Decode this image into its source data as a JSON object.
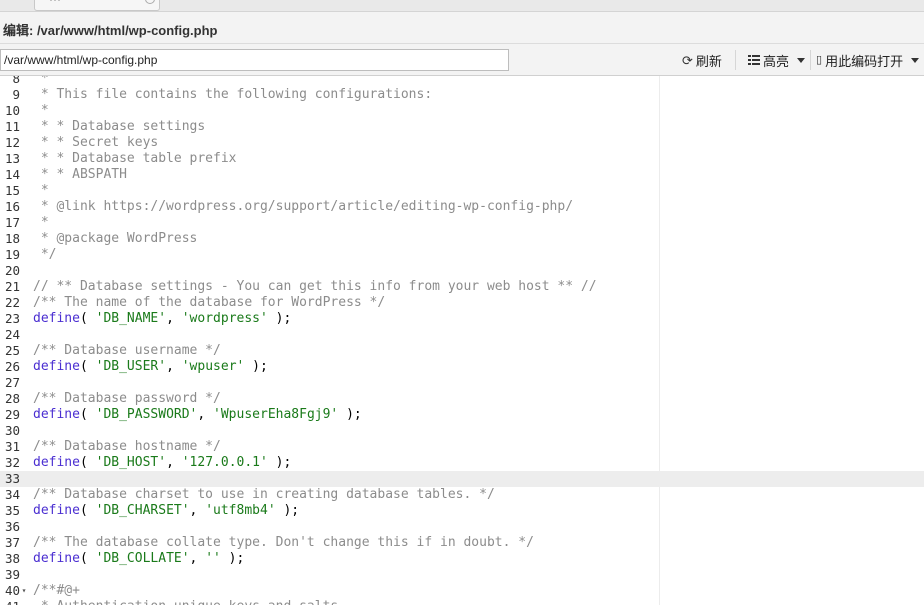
{
  "tab": {
    "label": "···"
  },
  "title": "编辑: /var/www/html/wp-config.php",
  "toolbar": {
    "path_value": "/var/www/html/wp-config.php",
    "refresh_label": "刷新",
    "highlight_label": "高亮",
    "open_with_label": "用此编码打开"
  },
  "editor": {
    "active_line": "33",
    "lines": [
      {
        "n": "8",
        "parts": [
          {
            "t": " *",
            "c": "cmt"
          }
        ]
      },
      {
        "n": "9",
        "parts": [
          {
            "t": " * This file contains the following configurations:",
            "c": "cmt"
          }
        ]
      },
      {
        "n": "10",
        "parts": [
          {
            "t": " *",
            "c": "cmt"
          }
        ]
      },
      {
        "n": "11",
        "parts": [
          {
            "t": " * * Database settings",
            "c": "cmt"
          }
        ]
      },
      {
        "n": "12",
        "parts": [
          {
            "t": " * * Secret keys",
            "c": "cmt"
          }
        ]
      },
      {
        "n": "13",
        "parts": [
          {
            "t": " * * Database table prefix",
            "c": "cmt"
          }
        ]
      },
      {
        "n": "14",
        "parts": [
          {
            "t": " * * ABSPATH",
            "c": "cmt"
          }
        ]
      },
      {
        "n": "15",
        "parts": [
          {
            "t": " *",
            "c": "cmt"
          }
        ]
      },
      {
        "n": "16",
        "parts": [
          {
            "t": " * @link https://wordpress.org/support/article/editing-wp-config-php/",
            "c": "cmt"
          }
        ]
      },
      {
        "n": "17",
        "parts": [
          {
            "t": " *",
            "c": "cmt"
          }
        ]
      },
      {
        "n": "18",
        "parts": [
          {
            "t": " * @package WordPress",
            "c": "cmt"
          }
        ]
      },
      {
        "n": "19",
        "parts": [
          {
            "t": " */",
            "c": "cmt"
          }
        ]
      },
      {
        "n": "20",
        "parts": []
      },
      {
        "n": "21",
        "parts": [
          {
            "t": "// ** Database settings - You can get this info from your web host ** //",
            "c": "cmt"
          }
        ]
      },
      {
        "n": "22",
        "parts": [
          {
            "t": "/** The name of the database for WordPress */",
            "c": "cmt"
          }
        ]
      },
      {
        "n": "23",
        "parts": [
          {
            "t": "define",
            "c": "def"
          },
          {
            "t": "( ",
            "c": "pun"
          },
          {
            "t": "'DB_NAME'",
            "c": "str"
          },
          {
            "t": ", ",
            "c": "pun"
          },
          {
            "t": "'wordpress'",
            "c": "str"
          },
          {
            "t": " );",
            "c": "pun"
          }
        ]
      },
      {
        "n": "24",
        "parts": []
      },
      {
        "n": "25",
        "parts": [
          {
            "t": "/** Database username */",
            "c": "cmt"
          }
        ]
      },
      {
        "n": "26",
        "parts": [
          {
            "t": "define",
            "c": "def"
          },
          {
            "t": "( ",
            "c": "pun"
          },
          {
            "t": "'DB_USER'",
            "c": "str"
          },
          {
            "t": ", ",
            "c": "pun"
          },
          {
            "t": "'wpuser'",
            "c": "str"
          },
          {
            "t": " );",
            "c": "pun"
          }
        ]
      },
      {
        "n": "27",
        "parts": []
      },
      {
        "n": "28",
        "parts": [
          {
            "t": "/** Database password */",
            "c": "cmt"
          }
        ]
      },
      {
        "n": "29",
        "parts": [
          {
            "t": "define",
            "c": "def"
          },
          {
            "t": "( ",
            "c": "pun"
          },
          {
            "t": "'DB_PASSWORD'",
            "c": "str"
          },
          {
            "t": ", ",
            "c": "pun"
          },
          {
            "t": "'WpuserEha8Fgj9'",
            "c": "str"
          },
          {
            "t": " );",
            "c": "pun"
          }
        ]
      },
      {
        "n": "30",
        "parts": []
      },
      {
        "n": "31",
        "parts": [
          {
            "t": "/** Database hostname */",
            "c": "cmt"
          }
        ]
      },
      {
        "n": "32",
        "parts": [
          {
            "t": "define",
            "c": "def"
          },
          {
            "t": "( ",
            "c": "pun"
          },
          {
            "t": "'DB_HOST'",
            "c": "str"
          },
          {
            "t": ", ",
            "c": "pun"
          },
          {
            "t": "'127.0.0.1'",
            "c": "str"
          },
          {
            "t": " );",
            "c": "pun"
          }
        ]
      },
      {
        "n": "33",
        "parts": []
      },
      {
        "n": "34",
        "parts": [
          {
            "t": "/** Database charset to use in creating database tables. */",
            "c": "cmt"
          }
        ]
      },
      {
        "n": "35",
        "parts": [
          {
            "t": "define",
            "c": "def"
          },
          {
            "t": "( ",
            "c": "pun"
          },
          {
            "t": "'DB_CHARSET'",
            "c": "str"
          },
          {
            "t": ", ",
            "c": "pun"
          },
          {
            "t": "'utf8mb4'",
            "c": "str"
          },
          {
            "t": " );",
            "c": "pun"
          }
        ]
      },
      {
        "n": "36",
        "parts": []
      },
      {
        "n": "37",
        "parts": [
          {
            "t": "/** The database collate type. Don't change this if in doubt. */",
            "c": "cmt"
          }
        ]
      },
      {
        "n": "38",
        "parts": [
          {
            "t": "define",
            "c": "def"
          },
          {
            "t": "( ",
            "c": "pun"
          },
          {
            "t": "'DB_COLLATE'",
            "c": "str"
          },
          {
            "t": ", ",
            "c": "pun"
          },
          {
            "t": "''",
            "c": "str"
          },
          {
            "t": " );",
            "c": "pun"
          }
        ]
      },
      {
        "n": "39",
        "parts": []
      },
      {
        "n": "40",
        "fold": "▾",
        "parts": [
          {
            "t": "/**#@+",
            "c": "cmt"
          }
        ]
      },
      {
        "n": "41",
        "parts": [
          {
            "t": " * Authentication unique keys and salts.",
            "c": "cmt"
          }
        ]
      }
    ]
  }
}
